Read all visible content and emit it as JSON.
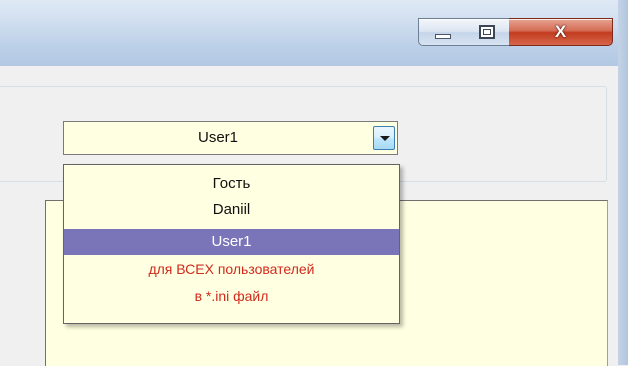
{
  "window": {
    "close_glyph": "X",
    "accent_titlebar": "#c8d8ec",
    "close_color": "#c33c20"
  },
  "user_combo": {
    "selected_value": "User1"
  },
  "dropdown": {
    "items": [
      {
        "label": "Гость",
        "selected": false
      },
      {
        "label": "Daniil",
        "selected": false
      },
      {
        "label": "User1",
        "selected": true
      },
      {
        "label": "для ВСЕХ пользователей",
        "selected": false,
        "color": "#d12a1e"
      },
      {
        "label": "в *.ini файл",
        "selected": false,
        "color": "#d12a1e"
      }
    ],
    "highlight_color": "#7a74b8"
  },
  "panel": {
    "background": "#ffffe1"
  }
}
